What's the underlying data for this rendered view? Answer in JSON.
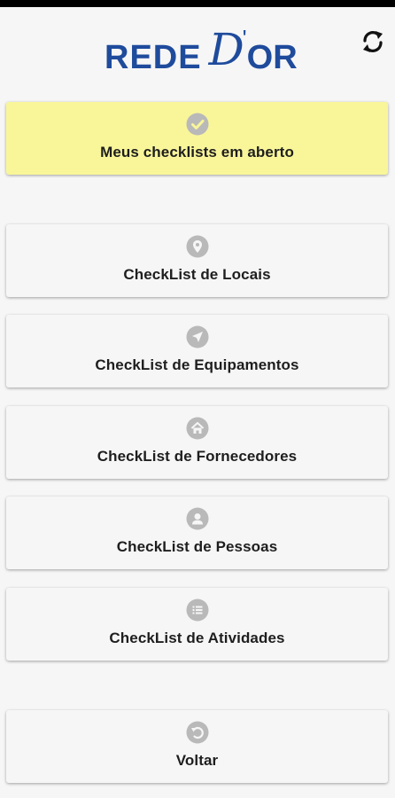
{
  "header": {
    "logo": {
      "part1": "REDE",
      "part2": "D",
      "apostrophe": "'",
      "part3": "OR"
    },
    "refresh_icon": "sync-icon",
    "brand_color": "#1f4b9c"
  },
  "menu": {
    "open_checklists": {
      "label": "Meus checklists em aberto",
      "icon": "check-circle-icon",
      "background": "#f9f69a"
    },
    "items": [
      {
        "label": "CheckList de Locais",
        "icon": "map-marker-icon"
      },
      {
        "label": "CheckList de Equipamentos",
        "icon": "location-arrow-icon"
      },
      {
        "label": "CheckList de Fornecedores",
        "icon": "home-icon"
      },
      {
        "label": "CheckList de Pessoas",
        "icon": "user-icon"
      },
      {
        "label": "CheckList de Atividades",
        "icon": "list-icon"
      }
    ],
    "back": {
      "label": "Voltar",
      "icon": "undo-icon"
    }
  },
  "colors": {
    "icon_gray": "#b9b9b9",
    "card_bg": "#f6f6f6",
    "text": "#1e1e1e"
  }
}
